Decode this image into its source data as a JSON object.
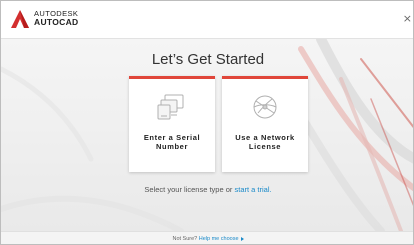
{
  "header": {
    "brand_line1": "AUTODESK",
    "brand_line2": "AUTOCAD",
    "close_label": "×"
  },
  "main": {
    "title": "Let’s Get Started",
    "cards": [
      {
        "label_line1": "Enter a Serial",
        "label_line2": "Number",
        "icon": "monitor-devices-icon"
      },
      {
        "label_line1": "Use a Network",
        "label_line2": "License",
        "icon": "globe-network-icon"
      }
    ],
    "license_text": "Select your license type or",
    "trial_link": "start a trial."
  },
  "footer": {
    "question": "Not Sure?",
    "help_link": "Help me choose"
  },
  "colors": {
    "accent_red": "#e0463a",
    "link_blue": "#1a8ac9"
  }
}
